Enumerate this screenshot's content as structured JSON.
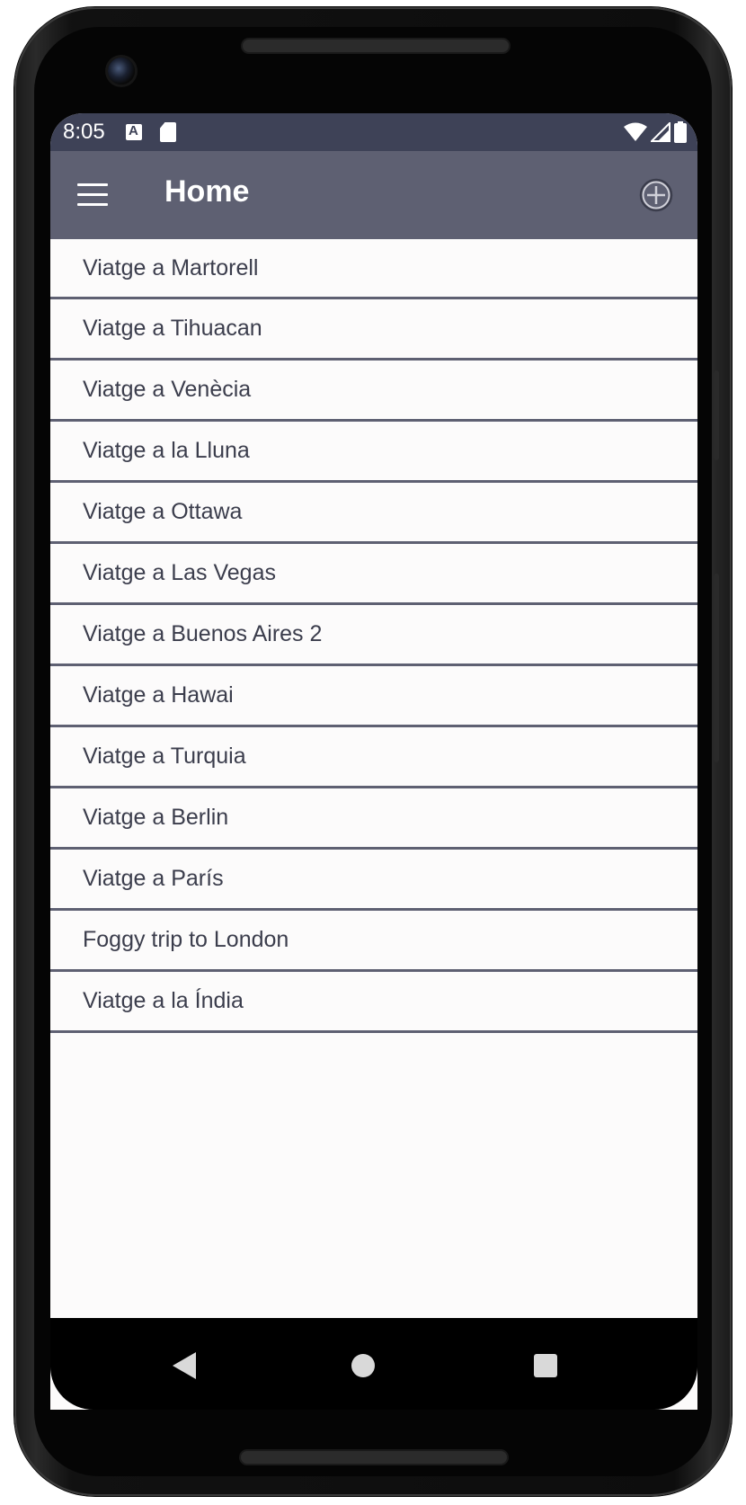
{
  "status_bar": {
    "time": "8:05",
    "icons": [
      "notification-a-icon",
      "sd-card-icon",
      "wifi-icon",
      "signal-icon",
      "battery-icon"
    ]
  },
  "app_bar": {
    "title": "Home",
    "menu_icon": "hamburger-menu-icon",
    "action_icon": "add-circle-icon"
  },
  "trips": [
    "Viatge a Martorell",
    "Viatge a Tihuacan",
    "Viatge a Venècia",
    "Viatge a la Lluna",
    "Viatge a Ottawa",
    "Viatge a Las Vegas",
    "Viatge a Buenos Aires 2",
    "Viatge a Hawai",
    "Viatge a Turquia",
    "Viatge a Berlin",
    "Viatge a París",
    "Foggy trip to London",
    "Viatge a la Índia"
  ],
  "nav_bar": {
    "icons": [
      "back-icon",
      "home-icon",
      "recent-apps-icon"
    ]
  },
  "colors": {
    "status_bar": "#3e4257",
    "app_bar": "#5e6072",
    "list_text": "#3b3d4c",
    "divider": "#5e6072",
    "background": "#fcfbfb"
  }
}
